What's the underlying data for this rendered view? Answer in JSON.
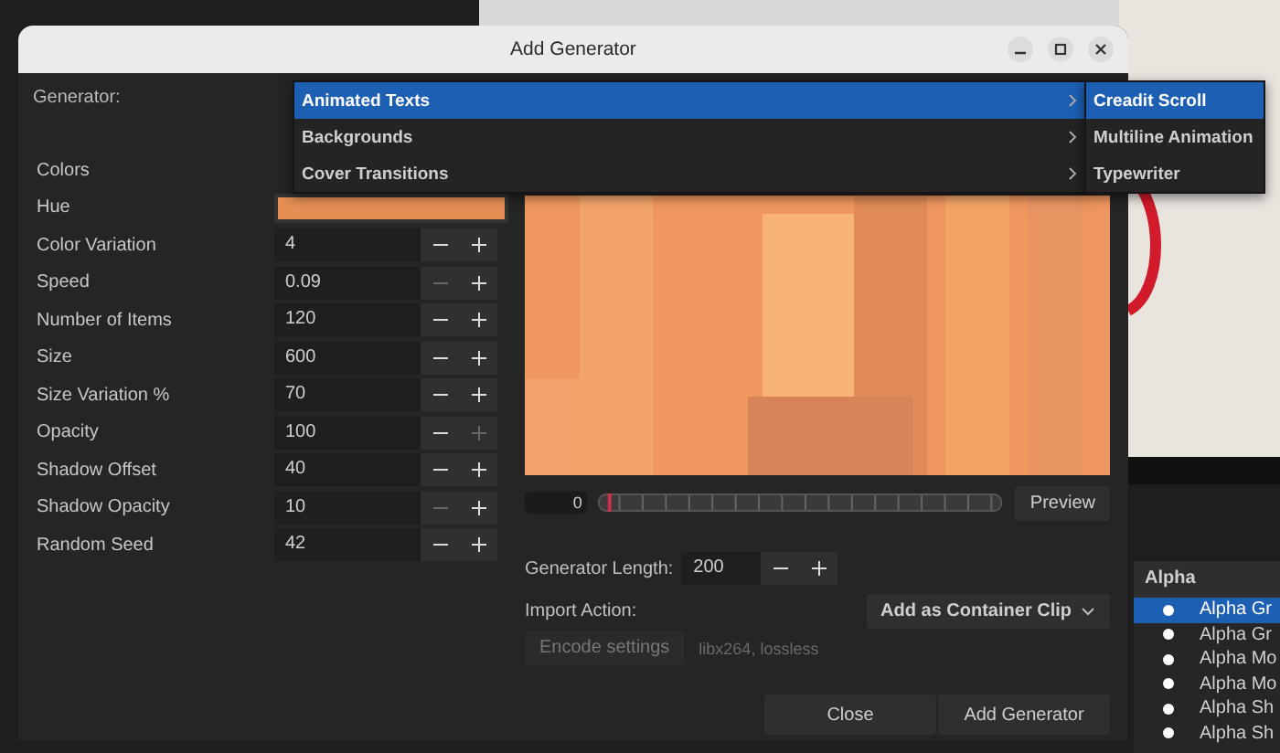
{
  "background_app": {
    "list_header": "Alpha",
    "list_items": [
      {
        "label": "Alpha Gr",
        "selected": true
      },
      {
        "label": "Alpha Gr",
        "selected": false
      },
      {
        "label": "Alpha Mo",
        "selected": false
      },
      {
        "label": "Alpha Mo",
        "selected": false
      },
      {
        "label": "Alpha Sh",
        "selected": false
      },
      {
        "label": "Alpha Sh",
        "selected": false
      }
    ]
  },
  "dialog": {
    "title": "Add Generator",
    "generator_label": "Generator:",
    "params": [
      {
        "kind": "hidden",
        "label": "Colors"
      },
      {
        "kind": "swatch",
        "label": "Hue"
      },
      {
        "kind": "spin",
        "label": "Color Variation",
        "value": "4",
        "minus_disabled": false,
        "plus_disabled": false
      },
      {
        "kind": "spin",
        "label": "Speed",
        "value": "0.09",
        "minus_disabled": true,
        "plus_disabled": false
      },
      {
        "kind": "spin",
        "label": "Number of Items",
        "value": "120",
        "minus_disabled": false,
        "plus_disabled": false
      },
      {
        "kind": "spin",
        "label": "Size",
        "value": "600",
        "minus_disabled": false,
        "plus_disabled": false
      },
      {
        "kind": "spin",
        "label": "Size Variation %",
        "value": "70",
        "minus_disabled": false,
        "plus_disabled": false
      },
      {
        "kind": "spin",
        "label": "Opacity",
        "value": "100",
        "minus_disabled": false,
        "plus_disabled": true
      },
      {
        "kind": "spin",
        "label": "Shadow Offset",
        "value": "40",
        "minus_disabled": false,
        "plus_disabled": false
      },
      {
        "kind": "spin",
        "label": "Shadow Opacity",
        "value": "10",
        "minus_disabled": true,
        "plus_disabled": false
      },
      {
        "kind": "spin",
        "label": "Random Seed",
        "value": "42",
        "minus_disabled": false,
        "plus_disabled": false
      }
    ],
    "frame_value": "0",
    "timeline": {
      "level": 0.02
    },
    "preview_button": "Preview",
    "length_label": "Generator Length:",
    "length_value": "200",
    "import_label": "Import Action:",
    "import_value": "Add as Container Clip",
    "encode_button": "Encode settings",
    "encode_info": "libx264, lossless",
    "buttons": [
      "Close",
      "Add Generator"
    ]
  },
  "menu": {
    "items": [
      {
        "label": "Animated Texts",
        "selected": true
      },
      {
        "label": "Backgrounds",
        "selected": false
      },
      {
        "label": "Cover Transitions",
        "selected": false
      }
    ],
    "submenu": [
      {
        "label": "Creadit Scroll",
        "selected": true
      },
      {
        "label": "Multiline Animation",
        "selected": false
      },
      {
        "label": "Typewriter",
        "selected": false
      }
    ]
  }
}
